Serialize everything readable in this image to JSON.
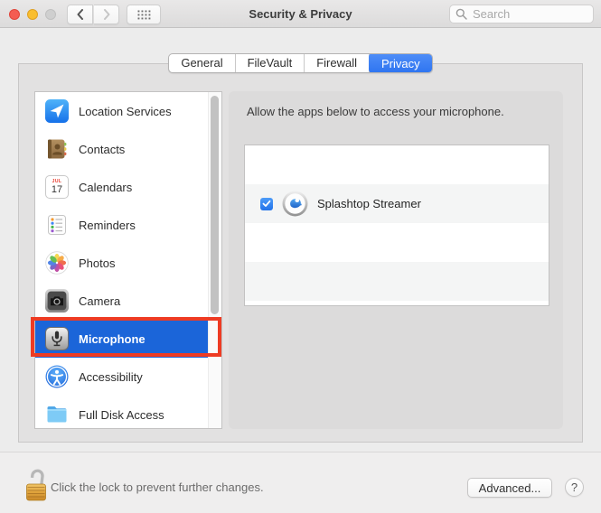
{
  "titlebar": {
    "title": "Security & Privacy",
    "search_placeholder": "Search"
  },
  "tabs": [
    {
      "label": "General",
      "selected": false
    },
    {
      "label": "FileVault",
      "selected": false
    },
    {
      "label": "Firewall",
      "selected": false
    },
    {
      "label": "Privacy",
      "selected": true
    }
  ],
  "sidebar": {
    "items": [
      {
        "label": "Location Services",
        "selected": false
      },
      {
        "label": "Contacts",
        "selected": false
      },
      {
        "label": "Calendars",
        "selected": false
      },
      {
        "label": "Reminders",
        "selected": false
      },
      {
        "label": "Photos",
        "selected": false
      },
      {
        "label": "Camera",
        "selected": false
      },
      {
        "label": "Microphone",
        "selected": true,
        "annotated": true
      },
      {
        "label": "Accessibility",
        "selected": false
      },
      {
        "label": "Full Disk Access",
        "selected": false
      }
    ]
  },
  "icons": {
    "calendar_month": "JUL",
    "calendar_day": "17"
  },
  "content": {
    "heading": "Allow the apps below to access your microphone.",
    "apps": [
      {
        "name": "Splashtop Streamer",
        "checked": true
      }
    ]
  },
  "footer": {
    "lock_text": "Click the lock to prevent further changes.",
    "advanced_button": "Advanced...",
    "help_button": "?"
  },
  "colors": {
    "selection_blue": "#1b65d9",
    "tab_blue": "#2e74f0",
    "tab_blue_light": "#4f8ef8",
    "annotation_red": "#ee3b23",
    "checkbox_blue": "#2273ea",
    "checkbox_blue_light": "#4d9bf8",
    "row_stripe": "#f4f5f5"
  }
}
